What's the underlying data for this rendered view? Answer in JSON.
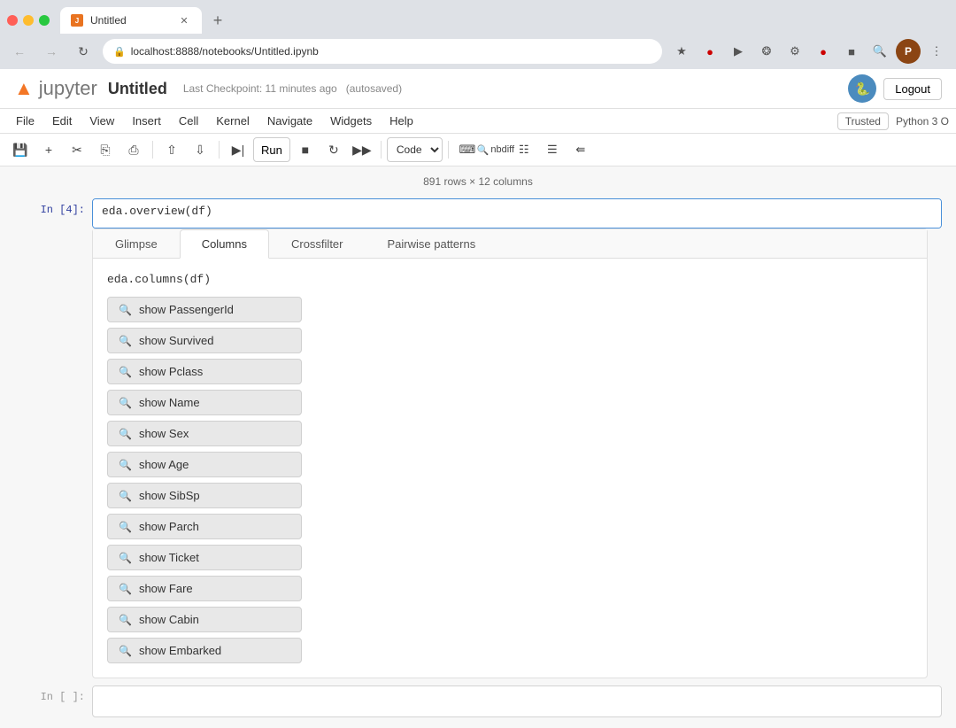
{
  "browser": {
    "tab_title": "Untitled",
    "address": "localhost:8888/notebooks/Untitled.ipynb",
    "tab_new_label": "+"
  },
  "jupyter": {
    "logo_text": "jupyter",
    "notebook_title": "Untitled",
    "checkpoint_text": "Last Checkpoint: 11 minutes ago",
    "autosaved_text": "(autosaved)",
    "logout_label": "Logout",
    "menu_items": [
      "File",
      "Edit",
      "View",
      "Insert",
      "Cell",
      "Kernel",
      "Navigate",
      "Widgets",
      "Help"
    ],
    "trusted_label": "Trusted",
    "kernel_label": "Python 3 O",
    "toolbar": {
      "run_label": "Run",
      "cell_type": "Code",
      "nbdiff_label": "nbdiff"
    }
  },
  "notebook": {
    "rows_info": "891 rows × 12 columns",
    "cell_in_label": "In [4]:",
    "cell_code": "eda.overview(df)",
    "output_tabs": [
      "Glimpse",
      "Columns",
      "Crossfilter",
      "Pairwise patterns"
    ],
    "active_tab": "Columns",
    "output_code": "eda.columns(df)",
    "columns": [
      {
        "label": "show PassengerId"
      },
      {
        "label": "show Survived"
      },
      {
        "label": "show Pclass"
      },
      {
        "label": "show Name"
      },
      {
        "label": "show Sex"
      },
      {
        "label": "show Age"
      },
      {
        "label": "show SibSp"
      },
      {
        "label": "show Parch"
      },
      {
        "label": "show Ticket"
      },
      {
        "label": "show Fare"
      },
      {
        "label": "show Cabin"
      },
      {
        "label": "show Embarked"
      }
    ],
    "empty_cell_label": "In [ ]:"
  }
}
